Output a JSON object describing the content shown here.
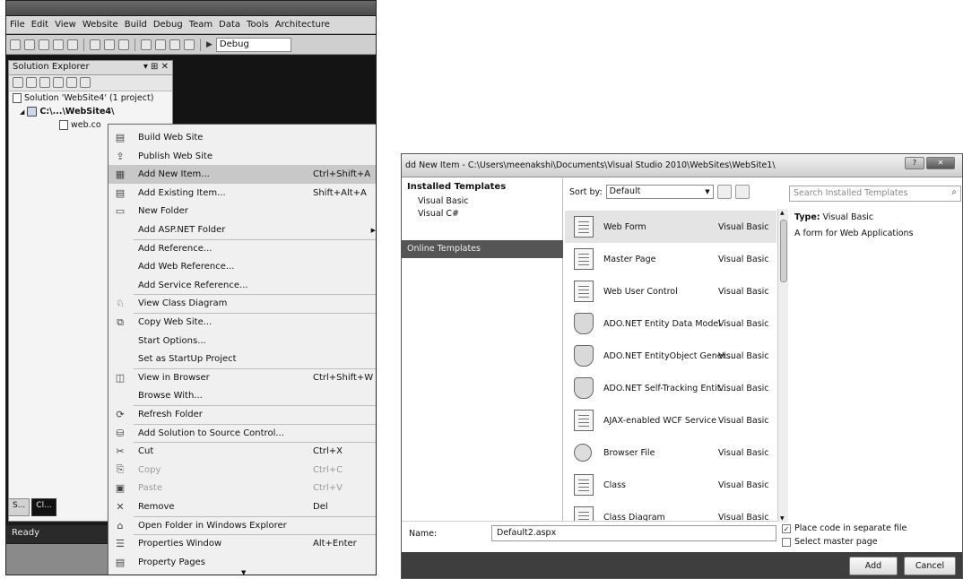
{
  "vs": {
    "menu": [
      "File",
      "Edit",
      "View",
      "Website",
      "Build",
      "Debug",
      "Team",
      "Data",
      "Tools",
      "Architecture"
    ],
    "toolbar": {
      "config": "Debug"
    },
    "solution_explorer": {
      "title": "Solution Explorer",
      "pin": "▾ ⊞ ✕",
      "solution": "Solution 'WebSite4' (1 project)",
      "project": "C:\\...\\WebSite4\\",
      "file": "web.co"
    },
    "bottom_tabs": [
      "S...",
      "Cl..."
    ],
    "status": "Ready"
  },
  "context_menu": {
    "items": [
      {
        "label": "Build Web Site",
        "shortcut": "",
        "icon": "build-icon"
      },
      {
        "label": "Publish Web Site",
        "shortcut": "",
        "icon": "publish-icon"
      },
      {
        "label": "Add New Item...",
        "shortcut": "Ctrl+Shift+A",
        "icon": "add-new-item-icon",
        "highlighted": true
      },
      {
        "label": "Add Existing Item...",
        "shortcut": "Shift+Alt+A",
        "icon": "add-existing-icon"
      },
      {
        "label": "New Folder",
        "shortcut": "",
        "icon": "folder-icon"
      },
      {
        "label": "Add ASP.NET Folder",
        "shortcut": "",
        "icon": "",
        "submenu": true
      },
      {
        "label": "Add Reference...",
        "shortcut": "",
        "icon": ""
      },
      {
        "label": "Add Web Reference...",
        "shortcut": "",
        "icon": ""
      },
      {
        "label": "Add Service Reference...",
        "shortcut": "",
        "icon": ""
      },
      {
        "label": "View Class Diagram",
        "shortcut": "",
        "icon": "class-diagram-icon"
      },
      {
        "label": "Copy Web Site...",
        "shortcut": "",
        "icon": "copy-site-icon"
      },
      {
        "label": "Start Options...",
        "shortcut": "",
        "icon": ""
      },
      {
        "label": "Set as StartUp Project",
        "shortcut": "",
        "icon": ""
      },
      {
        "label": "View in Browser",
        "shortcut": "Ctrl+Shift+W",
        "icon": "browser-icon"
      },
      {
        "label": "Browse With...",
        "shortcut": "",
        "icon": ""
      },
      {
        "label": "Refresh Folder",
        "shortcut": "",
        "icon": "refresh-icon"
      },
      {
        "label": "Add Solution to Source Control...",
        "shortcut": "",
        "icon": "source-control-icon"
      },
      {
        "label": "Cut",
        "shortcut": "Ctrl+X",
        "icon": "cut-icon"
      },
      {
        "label": "Copy",
        "shortcut": "Ctrl+C",
        "icon": "copy-icon",
        "disabled": true
      },
      {
        "label": "Paste",
        "shortcut": "Ctrl+V",
        "icon": "paste-icon",
        "disabled": true
      },
      {
        "label": "Remove",
        "shortcut": "Del",
        "icon": "remove-icon"
      },
      {
        "label": "Open Folder in Windows Explorer",
        "shortcut": "",
        "icon": "open-folder-icon"
      },
      {
        "label": "Properties Window",
        "shortcut": "Alt+Enter",
        "icon": "properties-icon"
      },
      {
        "label": "Property Pages",
        "shortcut": "",
        "icon": "property-pages-icon"
      }
    ]
  },
  "dialog": {
    "title": "dd New Item - C:\\Users\\meenakshi\\Documents\\Visual Studio 2010\\WebSites\\WebSite1\\",
    "installed_templates": "Installed Templates",
    "languages": [
      "Visual Basic",
      "Visual C#"
    ],
    "online_templates": "Online Templates",
    "sort_by_label": "Sort by:",
    "sort_by_value": "Default",
    "search_placeholder": "Search Installed Templates",
    "templates": [
      {
        "name": "Web Form",
        "type": "Visual Basic",
        "icon": "doc",
        "selected": true
      },
      {
        "name": "Master Page",
        "type": "Visual Basic",
        "icon": "doc"
      },
      {
        "name": "Web User Control",
        "type": "Visual Basic",
        "icon": "doc"
      },
      {
        "name": "ADO.NET Entity Data Model",
        "type": "Visual Basic",
        "icon": "db"
      },
      {
        "name": "ADO.NET EntityObject Gener...",
        "type": "Visual Basic",
        "icon": "db"
      },
      {
        "name": "ADO.NET Self-Tracking Entit...",
        "type": "Visual Basic",
        "icon": "db"
      },
      {
        "name": "AJAX-enabled WCF Service",
        "type": "Visual Basic",
        "icon": "doc"
      },
      {
        "name": "Browser File",
        "type": "Visual Basic",
        "icon": "gear"
      },
      {
        "name": "Class",
        "type": "Visual Basic",
        "icon": "doc"
      },
      {
        "name": "Class Diagram",
        "type": "Visual Basic",
        "icon": "doc"
      }
    ],
    "info": {
      "type_label": "Type:",
      "type_value": "Visual Basic",
      "description": "A form for Web Applications"
    },
    "name_label": "Name:",
    "name_value": "Default2.aspx",
    "place_code": "Place code in separate file",
    "place_code_checked": "✓",
    "select_master": "Select master page",
    "add_button": "Add",
    "cancel_button": "Cancel"
  }
}
